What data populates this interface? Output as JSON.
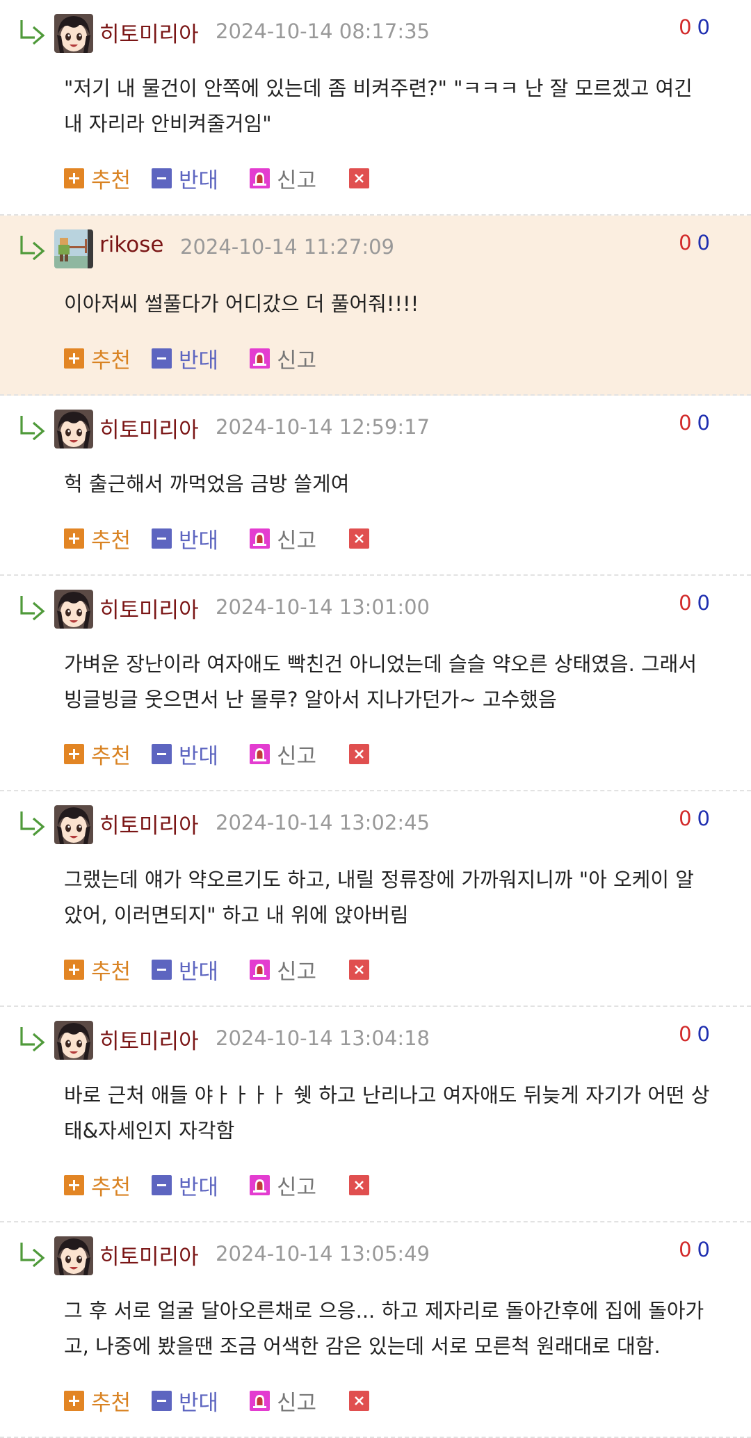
{
  "actions": {
    "recommend": "추천",
    "oppose": "반대",
    "report": "신고"
  },
  "icons": {
    "reply": "reply-arrow-icon",
    "recommend": "plus-icon",
    "oppose": "minus-icon",
    "report": "siren-icon",
    "delete": "close-icon"
  },
  "colors": {
    "nickname": "#7a1515",
    "upvote": "#d22a2a",
    "downvote": "#1f2fb0",
    "highlight_bg": "#fbeee0",
    "recommend": "#e28524",
    "oppose": "#5d65c0",
    "report": "#e33cd0",
    "delete": "#e04f4f"
  },
  "comments": [
    {
      "author": "히토미리아",
      "avatar": "anime-girl-avatar",
      "date": "2024-10-14 08:17:35",
      "up": "0",
      "down": "0",
      "text": "\"저기 내 물건이 안쪽에 있는데 좀 비켜주련?\" \"ㅋㅋㅋ 난 잘 모르겠고 여긴 내 자리라 안비켜줄거임\"",
      "deletable": true,
      "highlight": false
    },
    {
      "author": "rikose",
      "avatar": "pixel-character-avatar",
      "date": "2024-10-14 11:27:09",
      "up": "0",
      "down": "0",
      "text": "이아저씨 썰풀다가 어디갔으 더 풀어줘!!!!",
      "deletable": false,
      "highlight": true
    },
    {
      "author": "히토미리아",
      "avatar": "anime-girl-avatar",
      "date": "2024-10-14 12:59:17",
      "up": "0",
      "down": "0",
      "text": "헉 출근해서 까먹었음 금방 쓸게여",
      "deletable": true,
      "highlight": false
    },
    {
      "author": "히토미리아",
      "avatar": "anime-girl-avatar",
      "date": "2024-10-14 13:01:00",
      "up": "0",
      "down": "0",
      "text": "가벼운 장난이라 여자애도 빡친건 아니었는데 슬슬 약오른 상태였음. 그래서 빙글빙글 웃으면서 난 몰루? 알아서 지나가던가~ 고수했음",
      "deletable": true,
      "highlight": false
    },
    {
      "author": "히토미리아",
      "avatar": "anime-girl-avatar",
      "date": "2024-10-14 13:02:45",
      "up": "0",
      "down": "0",
      "text": "그랬는데 얘가 약오르기도 하고, 내릴 정류장에 가까워지니까 \"아 오케이 알았어, 이러면되지\" 하고 내 위에 앉아버림",
      "deletable": true,
      "highlight": false
    },
    {
      "author": "히토미리아",
      "avatar": "anime-girl-avatar",
      "date": "2024-10-14 13:04:18",
      "up": "0",
      "down": "0",
      "text": "바로 근처 애들 야ㅏㅏㅏㅏ 쉣 하고 난리나고 여자애도 뒤늦게 자기가 어떤 상태&자세인지 자각함",
      "deletable": true,
      "highlight": false
    },
    {
      "author": "히토미리아",
      "avatar": "anime-girl-avatar",
      "date": "2024-10-14 13:05:49",
      "up": "0",
      "down": "0",
      "text": "그 후 서로 얼굴 달아오른채로 으응... 하고 제자리로 돌아간후에 집에 돌아가고, 나중에 봤을땐 조금 어색한 감은 있는데 서로 모른척 원래대로 대함.",
      "deletable": true,
      "highlight": false
    }
  ]
}
